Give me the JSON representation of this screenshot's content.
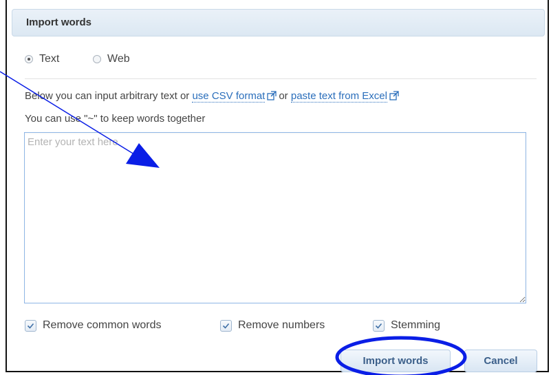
{
  "dialog": {
    "title": "Import words"
  },
  "source_options": [
    {
      "label": "Text",
      "selected": true
    },
    {
      "label": "Web",
      "selected": false
    }
  ],
  "instructions": {
    "prefix": "Below you can input arbitrary text or",
    "csv_link": "use CSV format",
    "connector": "or",
    "excel_link": "paste text from Excel",
    "hint": "You can use \"~\" to keep words together"
  },
  "text_input": {
    "value": "",
    "placeholder": "Enter your text here"
  },
  "options": {
    "remove_common_words": {
      "label": "Remove common words",
      "checked": true
    },
    "remove_numbers": {
      "label": "Remove numbers",
      "checked": true
    },
    "stemming": {
      "label": "Stemming",
      "checked": true
    }
  },
  "buttons": {
    "import_label": "Import words",
    "cancel_label": "Cancel"
  },
  "colors": {
    "link": "#2a6ebb",
    "annotation": "#0a1ee6",
    "header_bg": "#dce8f3",
    "button_text": "#3b5f8a"
  },
  "icons": [
    "external-link-icon",
    "checkmark-icon",
    "radio-icon"
  ]
}
